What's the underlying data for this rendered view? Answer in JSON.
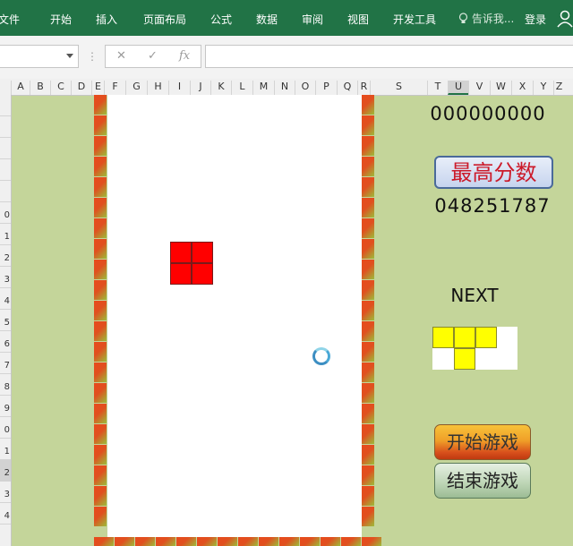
{
  "ribbon": {
    "tabs": [
      "文件",
      "开始",
      "插入",
      "页面布局",
      "公式",
      "数据",
      "审阅",
      "视图",
      "开发工具"
    ],
    "tell_me": "告诉我...",
    "login": "登录"
  },
  "formula_bar": {
    "cancel": "✕",
    "enter": "✓",
    "fx": "fx"
  },
  "columns": [
    "A",
    "B",
    "C",
    "D",
    "E",
    "F",
    "G",
    "H",
    "I",
    "J",
    "K",
    "L",
    "M",
    "N",
    "O",
    "P",
    "Q",
    "R",
    "S",
    "T",
    "U",
    "V",
    "W",
    "X",
    "Y",
    "Z"
  ],
  "selected_column": "U",
  "rows": [
    "",
    "",
    "",
    "",
    "",
    "0",
    "1",
    "2",
    "3",
    "4",
    "5",
    "6",
    "7",
    "8",
    "9",
    "0",
    "1",
    "2",
    "3",
    "4"
  ],
  "game": {
    "score": "000000000",
    "best_label": "最高分数",
    "best_score": "048251787",
    "next_label": "NEXT",
    "start_button": "开始游戏",
    "end_button": "结束游戏",
    "current_piece_color": "#ff0000",
    "next_piece_color": "#ffff00",
    "next_piece_cells": [
      [
        1,
        1,
        1,
        0
      ],
      [
        0,
        1,
        0,
        0
      ]
    ]
  }
}
